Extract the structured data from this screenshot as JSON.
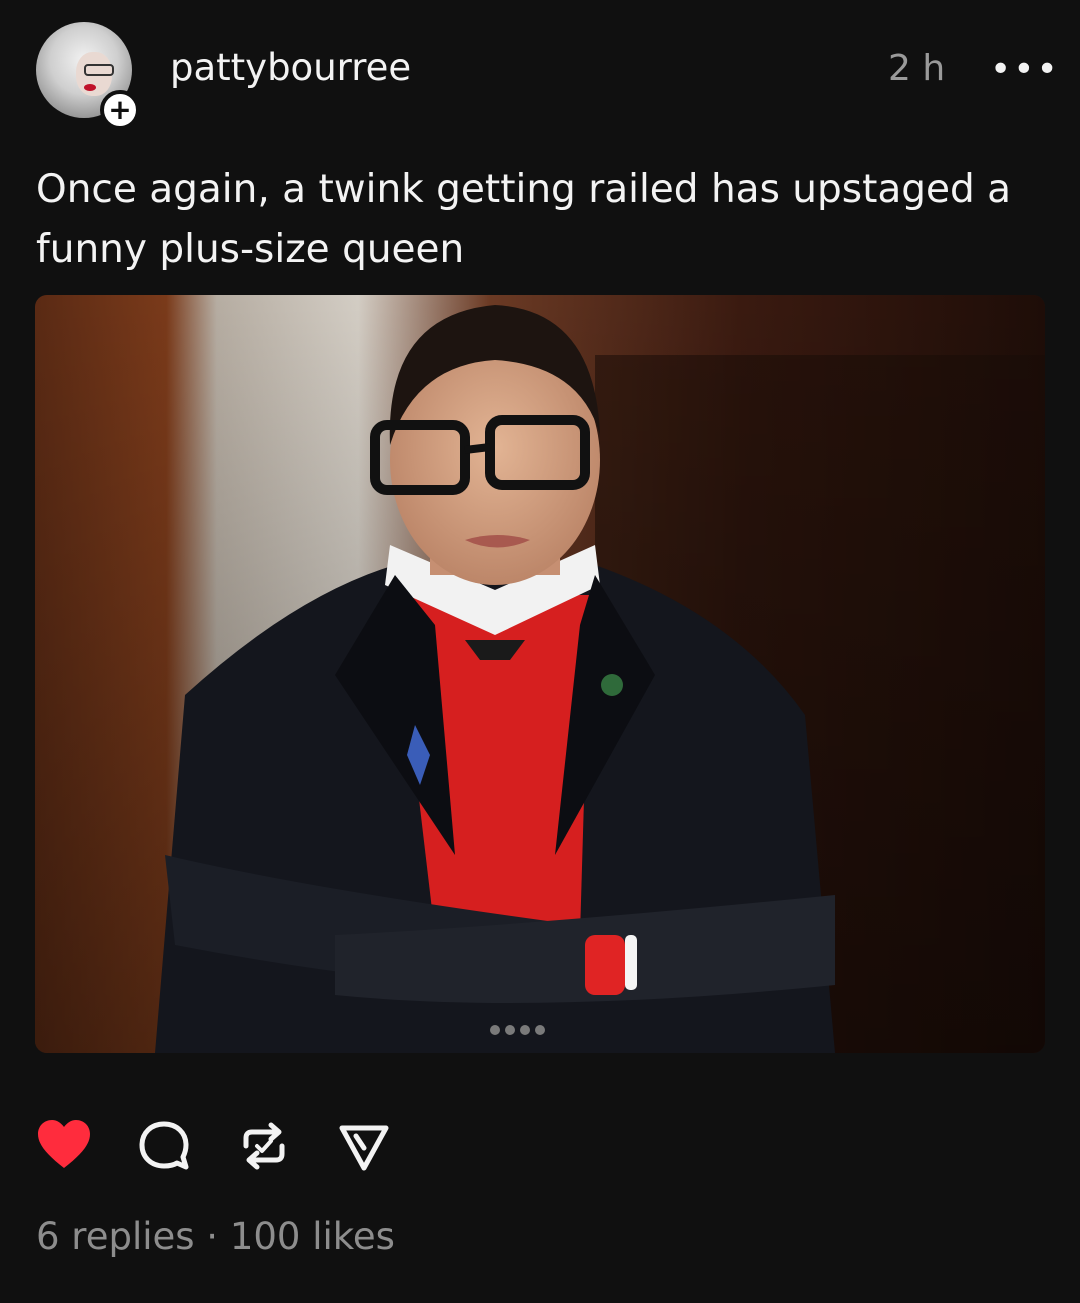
{
  "post": {
    "username": "pattybourree",
    "timestamp": "2 h",
    "more_label": "•••",
    "follow_label": "+",
    "caption": "Once again, a twink getting railed has upstaged a funny plus-size queen",
    "stats": "6 replies · 100 likes"
  },
  "actions": {
    "like_icon": "heart-filled",
    "reply_icon": "speech-bubble",
    "repost_icon": "repost-arrows",
    "share_icon": "paper-plane"
  },
  "colors": {
    "background": "#101010",
    "like": "#ff2c3d",
    "text": "#f3f3f3",
    "muted": "#8d8d8d"
  }
}
